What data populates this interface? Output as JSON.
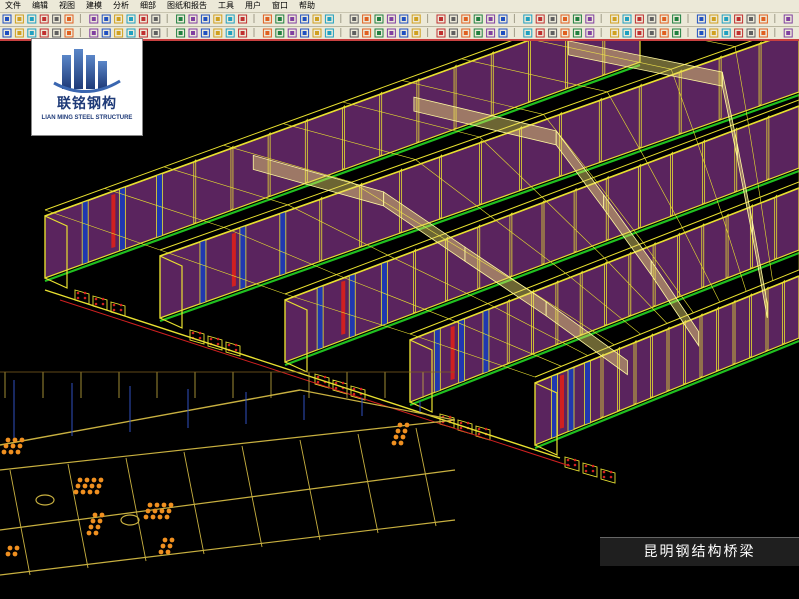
{
  "menu": {
    "items": [
      {
        "label": "文件"
      },
      {
        "label": "编辑"
      },
      {
        "label": "视图"
      },
      {
        "label": "建模"
      },
      {
        "label": "分析"
      },
      {
        "label": "细部"
      },
      {
        "label": "图纸和报告"
      },
      {
        "label": "工具"
      },
      {
        "label": "用户"
      },
      {
        "label": "窗口"
      },
      {
        "label": "帮助"
      }
    ]
  },
  "logo": {
    "cn": "联铭钢构",
    "en": "LIAN MING STEEL STRUCTURE",
    "colors": {
      "primary": "#1e3a78",
      "accent": "#3a66b0"
    }
  },
  "caption": {
    "text": "昆明钢结构桥梁"
  },
  "colors": {
    "frame": "#e8e030",
    "web_panel": "#6a2a6e",
    "blue_stiffener": "#1e3ab4",
    "red_stiffener": "#d02020",
    "green_flange": "#20c020",
    "crossbeam": "#f0e070",
    "bolt": "#f09020"
  }
}
